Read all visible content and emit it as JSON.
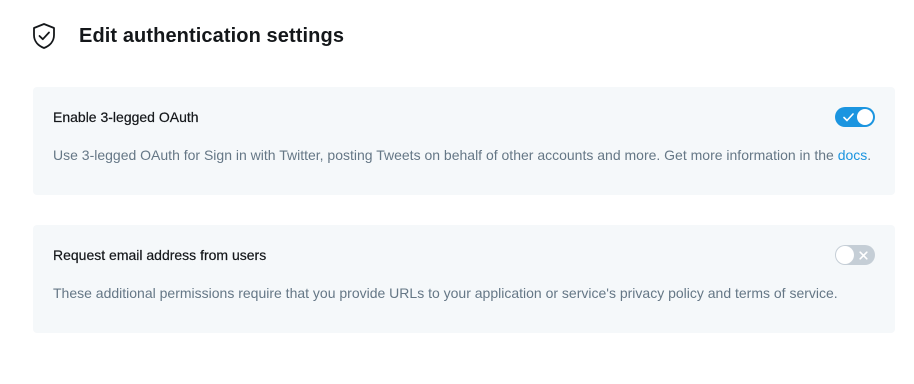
{
  "header": {
    "icon": "shield-check-icon",
    "title": "Edit authentication settings"
  },
  "settings": [
    {
      "title": "Enable 3-legged OAuth",
      "description_prefix": "Use 3-legged OAuth for Sign in with Twitter, posting Tweets on behalf of other accounts and more. Get more information in the ",
      "link_text": "docs",
      "description_suffix": ".",
      "enabled": true,
      "toggle_icon": "check-icon"
    },
    {
      "title": "Request email address from users",
      "description": "These additional permissions require that you provide URLs to your application or service's privacy policy and terms of service.",
      "enabled": false,
      "toggle_icon": "x-icon"
    }
  ],
  "colors": {
    "accent": "#1b95e0",
    "card_bg": "#f5f8fa",
    "muted_text": "#657786",
    "toggle_off": "#c5ced6"
  }
}
